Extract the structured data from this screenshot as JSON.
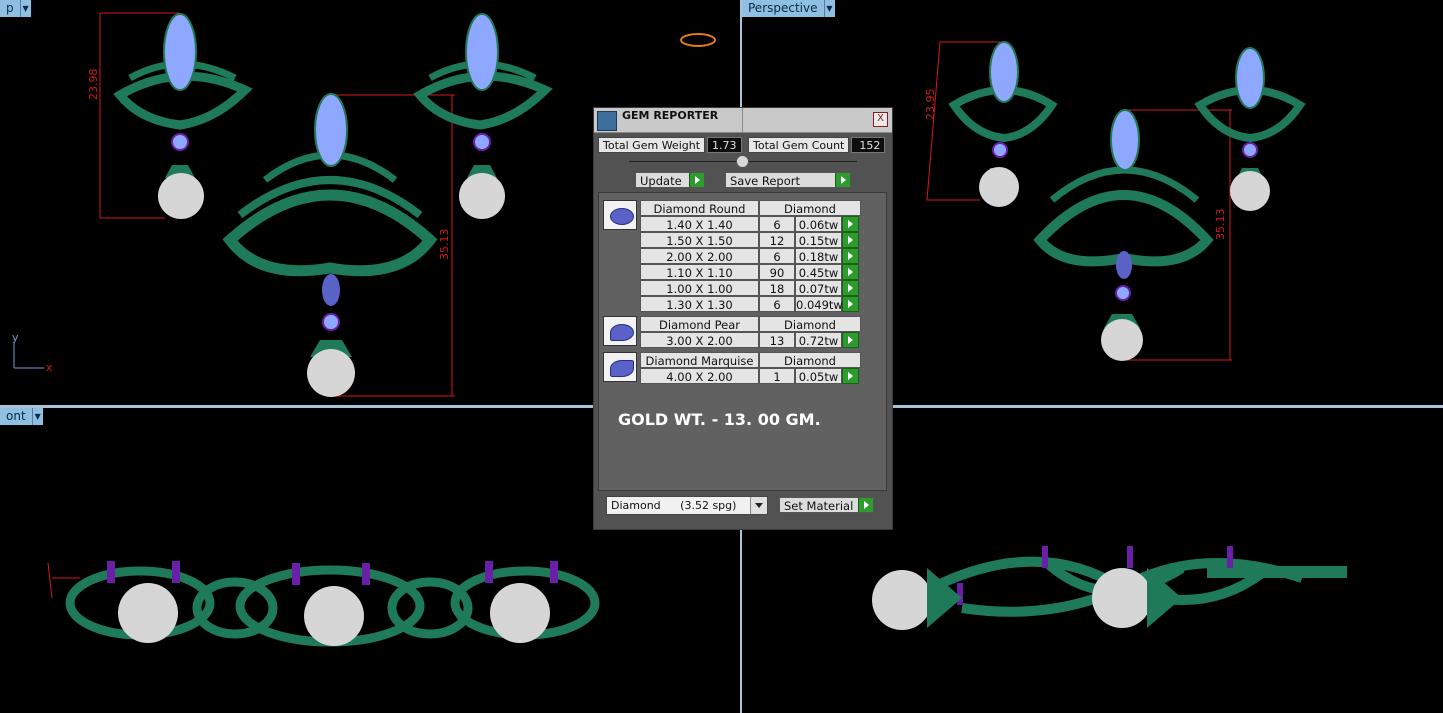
{
  "viewports": {
    "top_left": {
      "label": "p"
    },
    "top_right": {
      "label": "Perspective"
    },
    "bottom_left": {
      "label": "ont"
    }
  },
  "dimensions": {
    "tl_left": "23.98",
    "tl_center": "35.13",
    "tr_left": "23.95",
    "tr_center": "35.13"
  },
  "axes": {
    "y": "y",
    "x": "x"
  },
  "gem_reporter": {
    "title": "GEM REPORTER",
    "close": "X",
    "total_weight_label": "Total Gem Weight",
    "total_weight_value": "1.73",
    "total_count_label": "Total Gem Count",
    "total_count_value": "152",
    "update_label": "Update",
    "save_label": "Save Report",
    "groups": [
      {
        "name": "Diamond Round",
        "material": "Diamond",
        "rows": [
          {
            "size": "1.40 X 1.40",
            "count": "6",
            "weight": "0.06tw"
          },
          {
            "size": "1.50 X 1.50",
            "count": "12",
            "weight": "0.15tw"
          },
          {
            "size": "2.00 X 2.00",
            "count": "6",
            "weight": "0.18tw"
          },
          {
            "size": "1.10 X 1.10",
            "count": "90",
            "weight": "0.45tw"
          },
          {
            "size": "1.00 X 1.00",
            "count": "18",
            "weight": "0.07tw"
          },
          {
            "size": "1.30 X 1.30",
            "count": "6",
            "weight": "0.049tw"
          }
        ]
      },
      {
        "name": "Diamond Pear",
        "material": "Diamond",
        "rows": [
          {
            "size": "3.00 X 2.00",
            "count": "13",
            "weight": "0.72tw"
          }
        ]
      },
      {
        "name": "Diamond Marquise",
        "material": "Diamond",
        "rows": [
          {
            "size": "4.00 X 2.00",
            "count": "1",
            "weight": "0.05tw"
          }
        ]
      }
    ],
    "note": "GOLD WT. - 13. 00 GM.",
    "material_name": "Diamond",
    "material_spg": "(3.52 spg)",
    "set_material_label": "Set Material"
  },
  "colors": {
    "metal": "#1f7a5a",
    "diamond": "#8fa8ff",
    "setting": "#6a1fa8",
    "dimension": "#d01c1c",
    "accent": "#2e9b2e"
  }
}
